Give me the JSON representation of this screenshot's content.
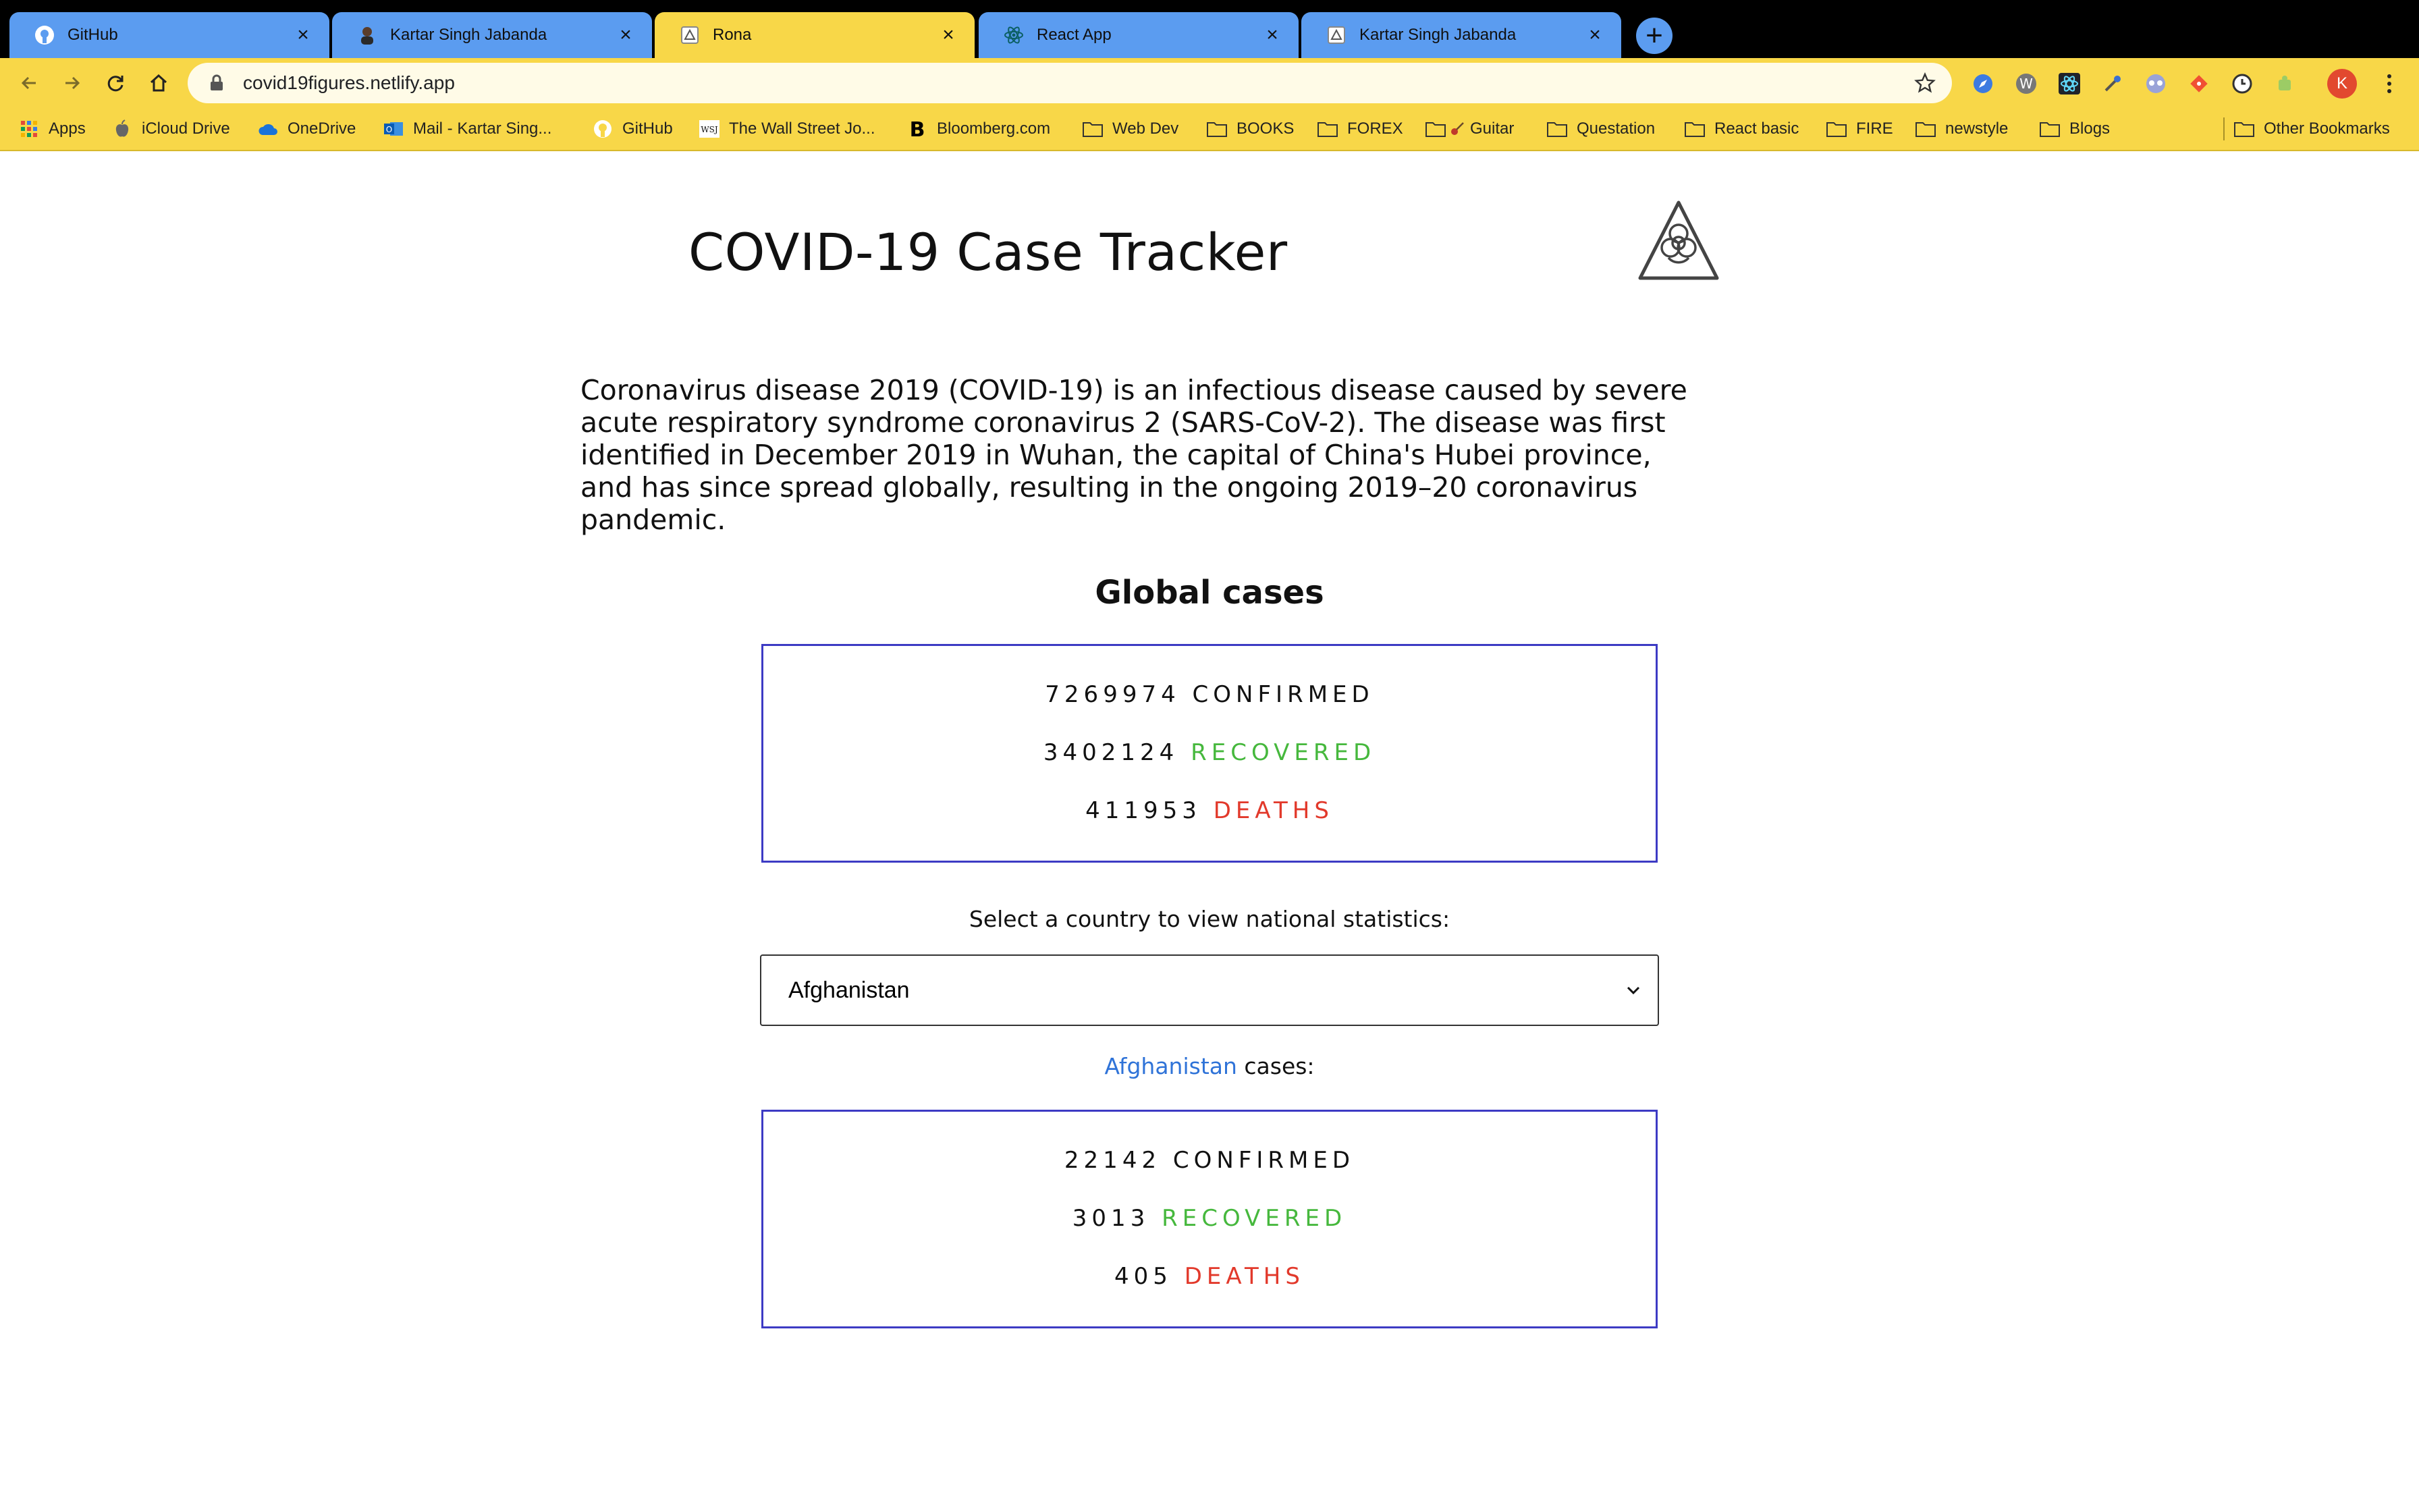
{
  "browser": {
    "tabs": [
      {
        "title": "GitHub",
        "icon": "github-icon",
        "active": false
      },
      {
        "title": "Kartar Singh Jabanda",
        "icon": "avatar-icon",
        "active": false
      },
      {
        "title": "Rona",
        "icon": "page-icon",
        "active": true
      },
      {
        "title": "React App",
        "icon": "react-icon",
        "active": false
      },
      {
        "title": "Kartar Singh Jabanda",
        "icon": "page-icon",
        "active": false
      }
    ],
    "new_tab": "+",
    "close_glyph": "×",
    "url": "covid19figures.netlify.app",
    "profile_initial": "K",
    "bookmarks": [
      {
        "label": "Apps",
        "icon": "apps-grid-icon"
      },
      {
        "label": "iCloud Drive",
        "icon": "apple-icon"
      },
      {
        "label": "OneDrive",
        "icon": "cloud-icon"
      },
      {
        "label": "Mail - Kartar Sing...",
        "icon": "outlook-icon"
      },
      {
        "label": "GitHub",
        "icon": "github-icon"
      },
      {
        "label": "The Wall Street Jo...",
        "icon": "wsj-icon"
      },
      {
        "label": "Bloomberg.com",
        "icon": "bloomberg-icon"
      },
      {
        "label": "Web Dev",
        "icon": "folder-icon"
      },
      {
        "label": "BOOKS",
        "icon": "folder-icon"
      },
      {
        "label": "FOREX",
        "icon": "folder-icon"
      },
      {
        "label": "Guitar",
        "icon": "folder-icon"
      },
      {
        "label": "Questation",
        "icon": "folder-icon"
      },
      {
        "label": "React basic",
        "icon": "folder-icon"
      },
      {
        "label": "FIRE",
        "icon": "folder-icon"
      },
      {
        "label": "newstyle",
        "icon": "folder-icon"
      },
      {
        "label": "Blogs",
        "icon": "folder-icon"
      },
      {
        "label": "Other Bookmarks",
        "icon": "folder-icon"
      }
    ],
    "colors": {
      "tab_inactive": "#5b9cf0",
      "chrome_yellow": "#f8d748"
    }
  },
  "page": {
    "title": "COVID-19 Case Tracker",
    "intro": "Coronavirus disease 2019 (COVID-19) is an infectious disease caused by severe acute respiratory syndrome coronavirus 2 (SARS-CoV-2). The disease was first identified in December 2019 in Wuhan, the capital of China's Hubei province, and has since spread globally, resulting in the ongoing 2019–20 coronavirus pandemic.",
    "global_heading": "Global cases",
    "global": {
      "confirmed": "7269974",
      "confirmed_label": "CONFIRMED",
      "recovered": "3402124",
      "recovered_label": "RECOVERED",
      "deaths": "411953",
      "deaths_label": "DEATHS"
    },
    "select_label": "Select a country to view national statistics:",
    "selected_country": "Afghanistan",
    "country_heading_suffix": " cases:",
    "country": {
      "confirmed": "22142",
      "confirmed_label": "CONFIRMED",
      "recovered": "3013",
      "recovered_label": "RECOVERED",
      "deaths": "405",
      "deaths_label": "DEATHS"
    },
    "colors": {
      "box_border": "#3d3bc4",
      "recovered": "#46b83d",
      "deaths": "#e2392b",
      "link": "#2f73d8"
    }
  }
}
